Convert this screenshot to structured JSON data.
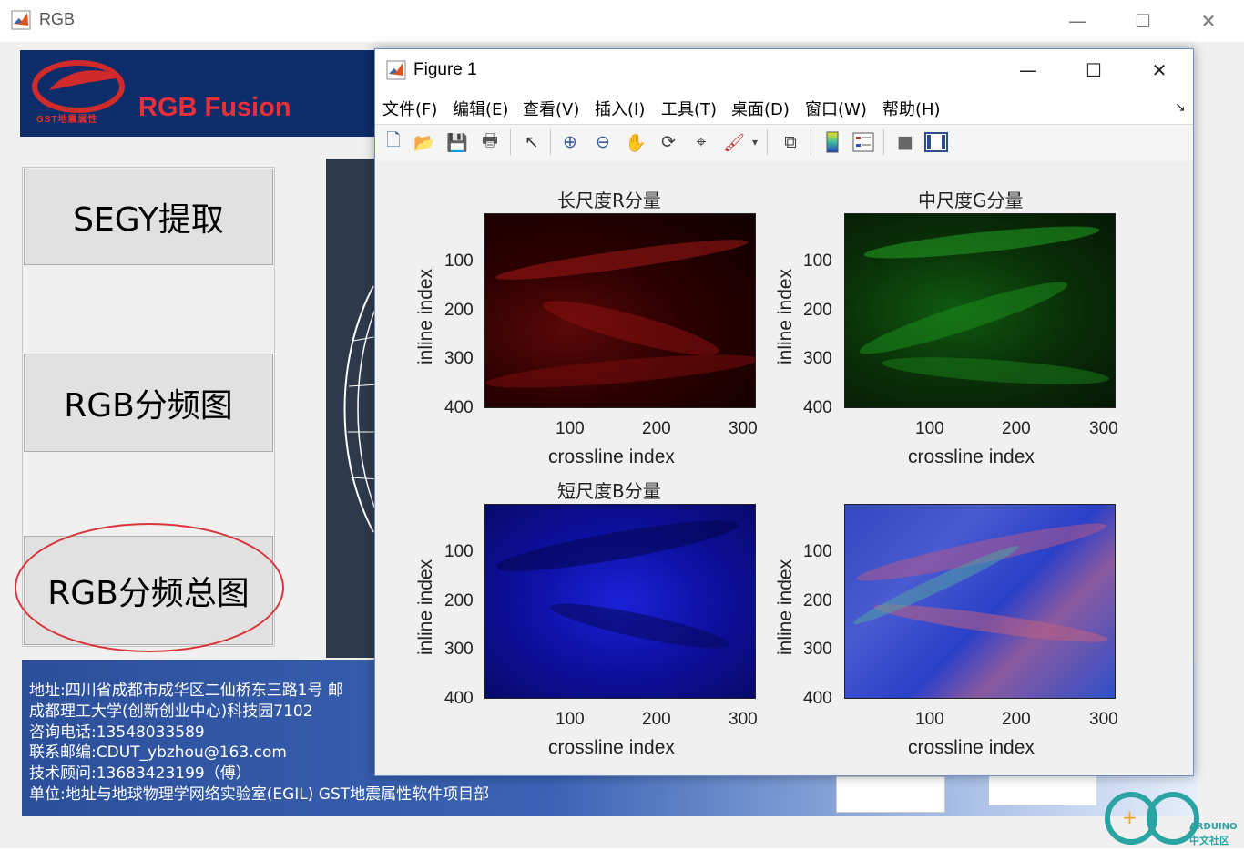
{
  "app": {
    "title": "RGB"
  },
  "banner": {
    "title": "RGB Fusion",
    "logo_text": "GST地震属性"
  },
  "buttons": {
    "segy": "SEGY提取",
    "rgb_freq": "RGB分频图",
    "rgb_total": "RGB分频总图"
  },
  "info": {
    "lines": [
      "地址:四川省成都市成华区二仙桥东三路1号  邮",
      "成都理工大学(创新创业中心)科技园7102",
      "咨询电话:13548033589",
      "联系邮编:CDUT_ybzhou@163.com",
      "技术顾问:13683423199（傅）",
      "单位:地址与地球物理学网络实验室(EGIL) GST地震属性软件项目部"
    ]
  },
  "figure": {
    "title": "Figure 1",
    "menu": [
      "文件(F)",
      "编辑(E)",
      "查看(V)",
      "插入(I)",
      "工具(T)",
      "桌面(D)",
      "窗口(W)",
      "帮助(H)"
    ],
    "axes": [
      {
        "title": "长尺度R分量",
        "xlabel": "crossline index",
        "ylabel": "inline index",
        "xticks": [
          "100",
          "200",
          "300"
        ],
        "yticks": [
          "100",
          "200",
          "300",
          "400"
        ],
        "colormap": "red"
      },
      {
        "title": "中尺度G分量",
        "xlabel": "crossline index",
        "ylabel": "inline index",
        "xticks": [
          "100",
          "200",
          "300"
        ],
        "yticks": [
          "100",
          "200",
          "300",
          "400"
        ],
        "colormap": "green"
      },
      {
        "title": "短尺度B分量",
        "xlabel": "crossline index",
        "ylabel": "inline index",
        "xticks": [
          "100",
          "200",
          "300"
        ],
        "yticks": [
          "100",
          "200",
          "300",
          "400"
        ],
        "colormap": "blue"
      },
      {
        "title": "",
        "xlabel": "crossline index",
        "ylabel": "inline index",
        "xticks": [
          "100",
          "200",
          "300"
        ],
        "yticks": [
          "100",
          "200",
          "300",
          "400"
        ],
        "colormap": "rgb-blend"
      }
    ]
  },
  "watermark": {
    "text1": "ARDUINO",
    "text2": "中文社区"
  },
  "colors": {
    "banner_bg": "#0d2c6a",
    "accent_red": "#e8303a",
    "highlight_circle": "#d9343a"
  }
}
